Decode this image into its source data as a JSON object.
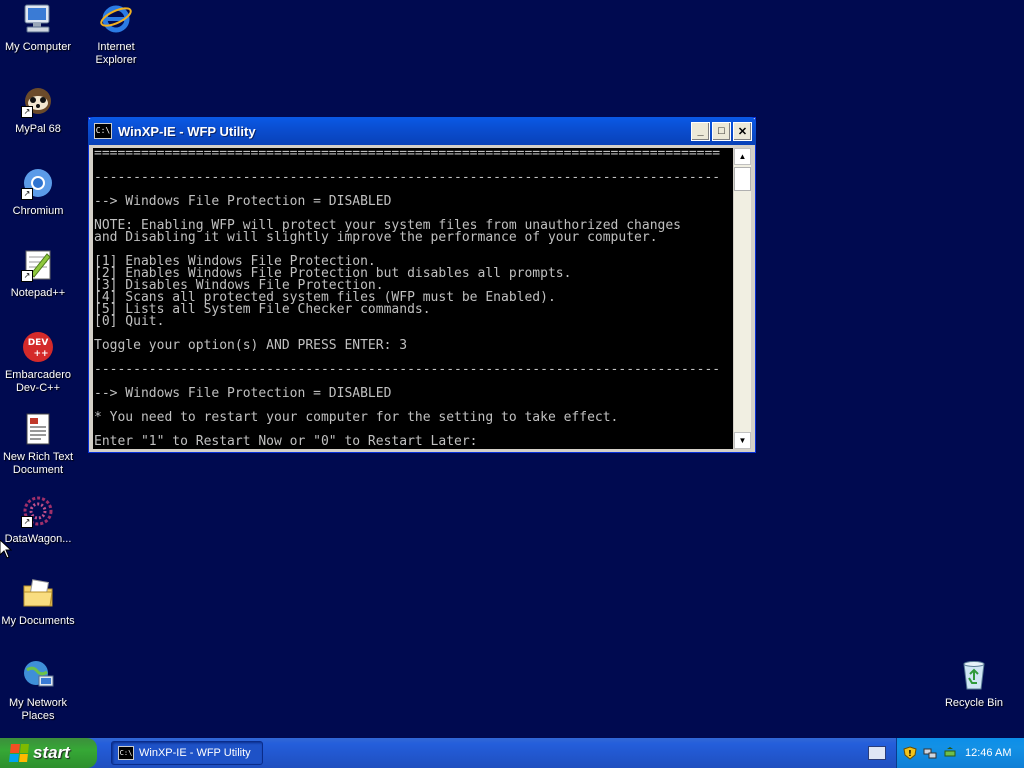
{
  "desktop": {
    "icons": [
      {
        "label": "My Computer",
        "icon": "my-computer-icon"
      },
      {
        "label": "Internet Explorer",
        "icon": "internet-explorer-icon"
      },
      {
        "label": "MyPal 68",
        "icon": "mypal-icon"
      },
      {
        "label": "Chromium",
        "icon": "chromium-icon"
      },
      {
        "label": "Notepad++",
        "icon": "notepadpp-icon"
      },
      {
        "label": "Embarcadero Dev-C++",
        "icon": "devcpp-icon"
      },
      {
        "label": "New Rich Text Document",
        "icon": "rtf-document-icon"
      },
      {
        "label": "DataWagon...",
        "icon": "datawagon-icon"
      },
      {
        "label": "My Documents",
        "icon": "my-documents-icon"
      },
      {
        "label": "My Network Places",
        "icon": "network-places-icon"
      },
      {
        "label": "Recycle Bin",
        "icon": "recycle-bin-icon"
      }
    ]
  },
  "window": {
    "title": "WinXP-IE - WFP Utility",
    "icon_text": "C:\\",
    "buttons": {
      "minimize": "_",
      "maximize": "□",
      "close": "✕"
    },
    "console_text": "================================================================================\n\n--------------------------------------------------------------------------------\n\n--> Windows File Protection = DISABLED\n\nNOTE: Enabling WFP will protect your system files from unauthorized changes\nand Disabling it will slightly improve the performance of your computer.\n\n[1] Enables Windows File Protection.\n[2] Enables Windows File Protection but disables all prompts.\n[3] Disables Windows File Protection.\n[4] Scans all protected system files (WFP must be Enabled).\n[5] Lists all System File Checker commands.\n[0] Quit.\n\nToggle your option(s) AND PRESS ENTER: 3\n\n--------------------------------------------------------------------------------\n\n--> Windows File Protection = DISABLED\n\n* You need to restart your computer for the setting to take effect.\n\nEnter \"1\" to Restart Now or \"0\" to Restart Later:"
  },
  "taskbar": {
    "start_label": "start",
    "task_button": "WinXP-IE - WFP Utility",
    "task_icon_text": "C:\\",
    "clock": "12:46 AM"
  },
  "colors": {
    "desktop_bg": "#000a50",
    "console_bg": "#000000",
    "console_fg": "#c0c0c0",
    "titlebar": "#0a4ccd"
  }
}
